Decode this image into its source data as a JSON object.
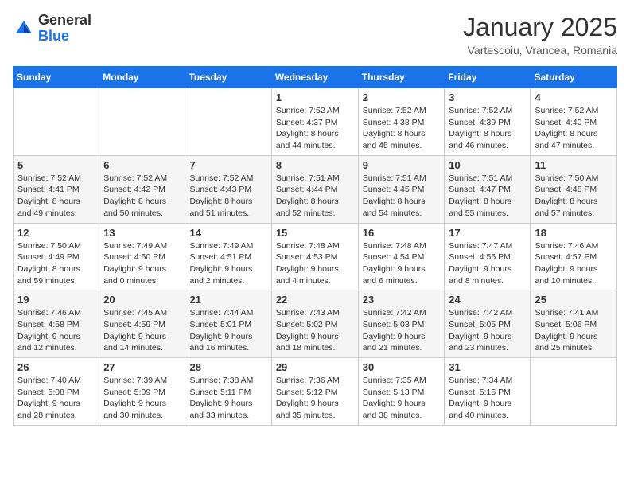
{
  "logo": {
    "general": "General",
    "blue": "Blue"
  },
  "title": "January 2025",
  "location": "Vartescoiu, Vrancea, Romania",
  "weekdays": [
    "Sunday",
    "Monday",
    "Tuesday",
    "Wednesday",
    "Thursday",
    "Friday",
    "Saturday"
  ],
  "weeks": [
    [
      {
        "day": "",
        "info": ""
      },
      {
        "day": "",
        "info": ""
      },
      {
        "day": "",
        "info": ""
      },
      {
        "day": "1",
        "info": "Sunrise: 7:52 AM\nSunset: 4:37 PM\nDaylight: 8 hours\nand 44 minutes."
      },
      {
        "day": "2",
        "info": "Sunrise: 7:52 AM\nSunset: 4:38 PM\nDaylight: 8 hours\nand 45 minutes."
      },
      {
        "day": "3",
        "info": "Sunrise: 7:52 AM\nSunset: 4:39 PM\nDaylight: 8 hours\nand 46 minutes."
      },
      {
        "day": "4",
        "info": "Sunrise: 7:52 AM\nSunset: 4:40 PM\nDaylight: 8 hours\nand 47 minutes."
      }
    ],
    [
      {
        "day": "5",
        "info": "Sunrise: 7:52 AM\nSunset: 4:41 PM\nDaylight: 8 hours\nand 49 minutes."
      },
      {
        "day": "6",
        "info": "Sunrise: 7:52 AM\nSunset: 4:42 PM\nDaylight: 8 hours\nand 50 minutes."
      },
      {
        "day": "7",
        "info": "Sunrise: 7:52 AM\nSunset: 4:43 PM\nDaylight: 8 hours\nand 51 minutes."
      },
      {
        "day": "8",
        "info": "Sunrise: 7:51 AM\nSunset: 4:44 PM\nDaylight: 8 hours\nand 52 minutes."
      },
      {
        "day": "9",
        "info": "Sunrise: 7:51 AM\nSunset: 4:45 PM\nDaylight: 8 hours\nand 54 minutes."
      },
      {
        "day": "10",
        "info": "Sunrise: 7:51 AM\nSunset: 4:47 PM\nDaylight: 8 hours\nand 55 minutes."
      },
      {
        "day": "11",
        "info": "Sunrise: 7:50 AM\nSunset: 4:48 PM\nDaylight: 8 hours\nand 57 minutes."
      }
    ],
    [
      {
        "day": "12",
        "info": "Sunrise: 7:50 AM\nSunset: 4:49 PM\nDaylight: 8 hours\nand 59 minutes."
      },
      {
        "day": "13",
        "info": "Sunrise: 7:49 AM\nSunset: 4:50 PM\nDaylight: 9 hours\nand 0 minutes."
      },
      {
        "day": "14",
        "info": "Sunrise: 7:49 AM\nSunset: 4:51 PM\nDaylight: 9 hours\nand 2 minutes."
      },
      {
        "day": "15",
        "info": "Sunrise: 7:48 AM\nSunset: 4:53 PM\nDaylight: 9 hours\nand 4 minutes."
      },
      {
        "day": "16",
        "info": "Sunrise: 7:48 AM\nSunset: 4:54 PM\nDaylight: 9 hours\nand 6 minutes."
      },
      {
        "day": "17",
        "info": "Sunrise: 7:47 AM\nSunset: 4:55 PM\nDaylight: 9 hours\nand 8 minutes."
      },
      {
        "day": "18",
        "info": "Sunrise: 7:46 AM\nSunset: 4:57 PM\nDaylight: 9 hours\nand 10 minutes."
      }
    ],
    [
      {
        "day": "19",
        "info": "Sunrise: 7:46 AM\nSunset: 4:58 PM\nDaylight: 9 hours\nand 12 minutes."
      },
      {
        "day": "20",
        "info": "Sunrise: 7:45 AM\nSunset: 4:59 PM\nDaylight: 9 hours\nand 14 minutes."
      },
      {
        "day": "21",
        "info": "Sunrise: 7:44 AM\nSunset: 5:01 PM\nDaylight: 9 hours\nand 16 minutes."
      },
      {
        "day": "22",
        "info": "Sunrise: 7:43 AM\nSunset: 5:02 PM\nDaylight: 9 hours\nand 18 minutes."
      },
      {
        "day": "23",
        "info": "Sunrise: 7:42 AM\nSunset: 5:03 PM\nDaylight: 9 hours\nand 21 minutes."
      },
      {
        "day": "24",
        "info": "Sunrise: 7:42 AM\nSunset: 5:05 PM\nDaylight: 9 hours\nand 23 minutes."
      },
      {
        "day": "25",
        "info": "Sunrise: 7:41 AM\nSunset: 5:06 PM\nDaylight: 9 hours\nand 25 minutes."
      }
    ],
    [
      {
        "day": "26",
        "info": "Sunrise: 7:40 AM\nSunset: 5:08 PM\nDaylight: 9 hours\nand 28 minutes."
      },
      {
        "day": "27",
        "info": "Sunrise: 7:39 AM\nSunset: 5:09 PM\nDaylight: 9 hours\nand 30 minutes."
      },
      {
        "day": "28",
        "info": "Sunrise: 7:38 AM\nSunset: 5:11 PM\nDaylight: 9 hours\nand 33 minutes."
      },
      {
        "day": "29",
        "info": "Sunrise: 7:36 AM\nSunset: 5:12 PM\nDaylight: 9 hours\nand 35 minutes."
      },
      {
        "day": "30",
        "info": "Sunrise: 7:35 AM\nSunset: 5:13 PM\nDaylight: 9 hours\nand 38 minutes."
      },
      {
        "day": "31",
        "info": "Sunrise: 7:34 AM\nSunset: 5:15 PM\nDaylight: 9 hours\nand 40 minutes."
      },
      {
        "day": "",
        "info": ""
      }
    ]
  ]
}
